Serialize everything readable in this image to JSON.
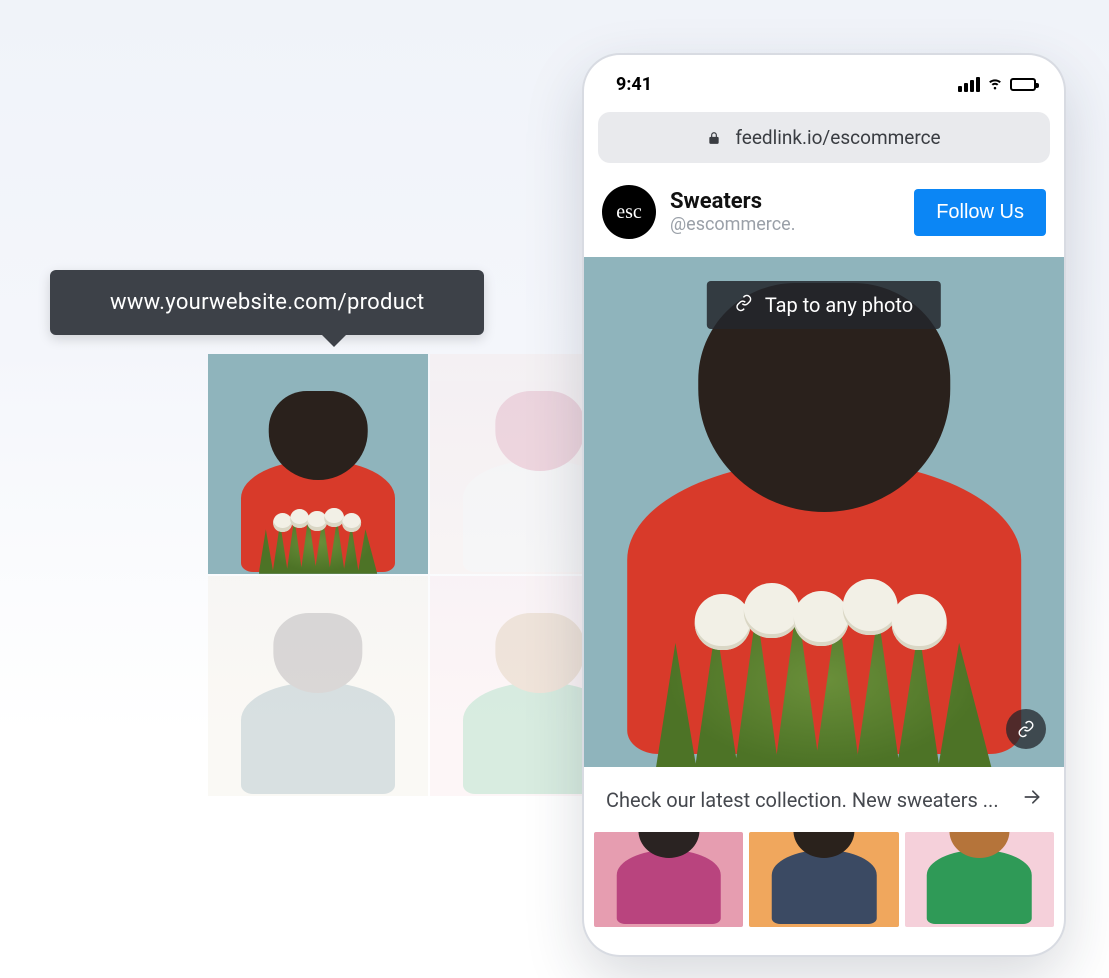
{
  "tooltip": {
    "url": "www.yourwebsite.com/product"
  },
  "phone": {
    "status": {
      "time": "9:41"
    },
    "address_bar": {
      "url": "feedlink.io/escommerce"
    },
    "profile": {
      "avatar_text": "esc",
      "name": "Sweaters",
      "handle": "@escommerce.",
      "follow_label": "Follow Us"
    },
    "hero": {
      "tap_label": "Tap to any photo"
    },
    "caption": "Check our latest collection. New sweaters ..."
  },
  "colors": {
    "accent": "#0b86f5",
    "tooltip_bg": "#3d4148"
  }
}
